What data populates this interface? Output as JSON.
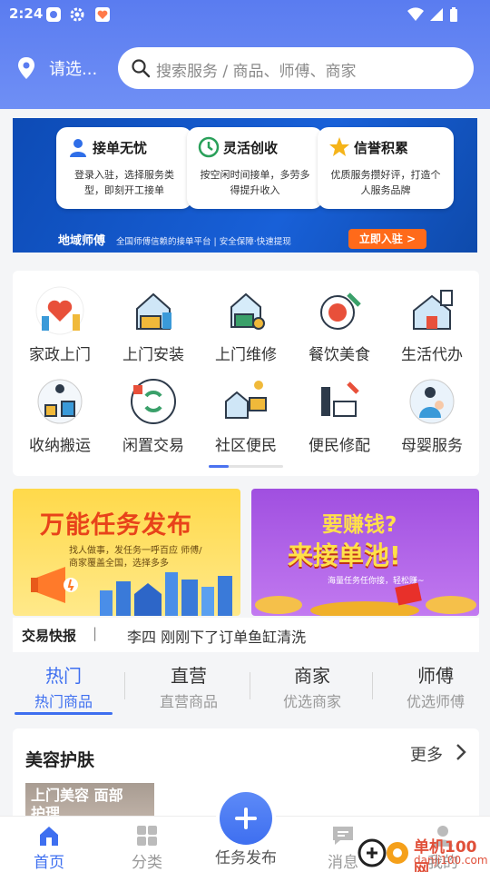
{
  "status_bar": {
    "time": "2:24"
  },
  "header": {
    "location_text": "请选...",
    "search_placeholder": "搜索服务 / 商品、师傅、商家"
  },
  "banner": {
    "cards": [
      {
        "title": "接单无忧",
        "icon": "user-icon",
        "desc": "登录入驻，选择服务类型，即刻开工接单"
      },
      {
        "title": "灵活创收",
        "icon": "clock-icon",
        "desc": "按空闲时间接单，多劳多得提升收入"
      },
      {
        "title": "信誉积累",
        "icon": "star-icon",
        "desc": "优质服务攒好评，打造个人服务品牌"
      }
    ],
    "brand": "地域师傅",
    "slogan": "全国师傅信赖的接单平台 | 安全保障·快速提现",
    "cta": "立即入驻 >"
  },
  "categories": [
    {
      "label": "家政上门",
      "icon": "housekeeping-icon"
    },
    {
      "label": "上门安装",
      "icon": "installation-icon"
    },
    {
      "label": "上门维修",
      "icon": "repair-icon"
    },
    {
      "label": "餐饮美食",
      "icon": "dining-icon"
    },
    {
      "label": "生活代办",
      "icon": "errand-icon"
    },
    {
      "label": "收纳搬运",
      "icon": "moving-icon"
    },
    {
      "label": "闲置交易",
      "icon": "secondhand-icon"
    },
    {
      "label": "社区便民",
      "icon": "community-icon"
    },
    {
      "label": "便民修配",
      "icon": "tools-icon"
    },
    {
      "label": "母婴服务",
      "icon": "maternal-icon"
    }
  ],
  "promos": [
    {
      "title": "万能任务发布",
      "sub": "找人做事，发任务一呼百应 师傅/商家覆盖全国，选择多多"
    },
    {
      "title1": "要赚钱?",
      "title2": "来接单池!",
      "sub": "海量任务任你接，轻松赚~"
    }
  ],
  "ticker": {
    "label": "交易快报",
    "separator": "|",
    "message": "李四 刚刚下了订单鱼缸清洗"
  },
  "tabs": [
    {
      "title": "热门",
      "sub": "热门商品",
      "active": true
    },
    {
      "title": "直营",
      "sub": "直营商品",
      "active": false
    },
    {
      "title": "商家",
      "sub": "优选商家",
      "active": false
    },
    {
      "title": "师傅",
      "sub": "优选师傅",
      "active": false
    }
  ],
  "section": {
    "title": "美容护肤",
    "more": "更多",
    "thumb_text": "上门美容 面部护理"
  },
  "nav": {
    "items": [
      {
        "label": "首页",
        "icon": "home-icon",
        "active": true
      },
      {
        "label": "分类",
        "icon": "grid-icon",
        "active": false
      },
      {
        "label": "消息",
        "icon": "message-icon",
        "active": false
      },
      {
        "label": "我的",
        "icon": "profile-icon",
        "active": false
      }
    ],
    "fab_label": "任务发布"
  },
  "watermark": {
    "text": "单机100网",
    "url": "danji100.com"
  },
  "colors": {
    "primary": "#3e6ff0",
    "header": "#5a7cf0",
    "accent_orange": "#ff6a1a"
  }
}
